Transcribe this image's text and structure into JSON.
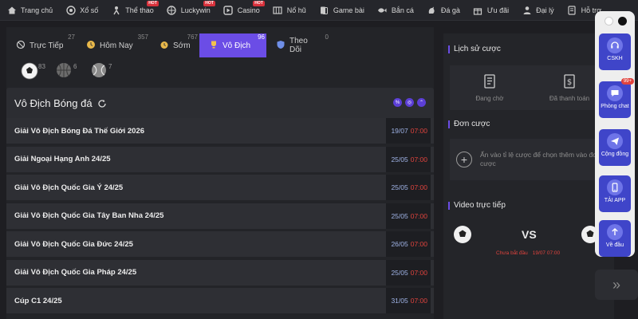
{
  "nav": [
    {
      "label": "Trang chủ",
      "icon": "home-icon",
      "hot": false
    },
    {
      "label": "Xổ số",
      "icon": "lottery-icon",
      "hot": false
    },
    {
      "label": "Thể thao",
      "icon": "sport-icon",
      "hot": true
    },
    {
      "label": "Luckywin",
      "icon": "luckywin-icon",
      "hot": true
    },
    {
      "label": "Casino",
      "icon": "casino-icon",
      "hot": true
    },
    {
      "label": "Nổ hũ",
      "icon": "slot-icon",
      "hot": false
    },
    {
      "label": "Game bài",
      "icon": "cards-icon",
      "hot": false
    },
    {
      "label": "Bắn cá",
      "icon": "fish-icon",
      "hot": false
    },
    {
      "label": "Đá gà",
      "icon": "rooster-icon",
      "hot": false
    },
    {
      "label": "Ưu đãi",
      "icon": "gift-icon",
      "hot": false
    },
    {
      "label": "Đại lý",
      "icon": "agent-icon",
      "hot": false
    },
    {
      "label": "Hỗ trợ",
      "icon": "support-icon",
      "hot": false
    }
  ],
  "hot_label": "HOT",
  "tabs": [
    {
      "label": "Trực Tiếp",
      "count": "27"
    },
    {
      "label": "Hôm Nay",
      "count": "357"
    },
    {
      "label": "Sớm",
      "count": "767"
    },
    {
      "label": "Vô Địch",
      "count": "96"
    },
    {
      "label": "Theo Dõi",
      "count": "0"
    }
  ],
  "sports": [
    {
      "icon": "soccer-ball-icon",
      "count": "83"
    },
    {
      "icon": "basketball-icon",
      "count": "6"
    },
    {
      "icon": "tennis-ball-icon",
      "count": "7"
    }
  ],
  "champ": {
    "title": "Vô Địch Bóng đá"
  },
  "rows": [
    {
      "name": "Giải Vô Địch Bóng Đá Thế Giới 2026",
      "date": "19/07",
      "time": "07:00"
    },
    {
      "name": "Giải Ngoại Hạng Anh 24/25",
      "date": "25/05",
      "time": "07:00"
    },
    {
      "name": "Giải Vô Địch Quốc Gia Ý 24/25",
      "date": "25/05",
      "time": "07:00"
    },
    {
      "name": "Giải Vô Địch Quốc Gia Tây Ban Nha 24/25",
      "date": "25/05",
      "time": "07:00"
    },
    {
      "name": "Giải Vô Địch Quốc Gia Đức 24/25",
      "date": "26/05",
      "time": "07:00"
    },
    {
      "name": "Giải Vô Địch Quốc Gia Pháp 24/25",
      "date": "25/05",
      "time": "07:00"
    },
    {
      "name": "Cúp C1 24/25",
      "date": "31/05",
      "time": "07:00"
    }
  ],
  "right": {
    "history_title": "Lịch sử cược",
    "pending": "Đang chờ",
    "paid": "Đã thanh toán",
    "slip_title": "Đơn cược",
    "slip_hint": "Ấn vào tỉ lệ cược để chọn thêm vào đơn cược",
    "video_title": "Video trực tiếp",
    "vs": "VS",
    "not_started": "Chưa bắt đầu",
    "video_time": "19/07 07:00"
  },
  "side": {
    "cskh": "CSKH",
    "chat": "Phòng chat",
    "chat_badge": "99+",
    "community": "Cộng đồng",
    "app": "TẢI APP",
    "top": "Về đầu",
    "more": "»"
  },
  "colors": {
    "accent": "#6b4de6",
    "side_button": "#3f45c9",
    "time_red": "#e0433d",
    "date_blue": "#9fb3e6"
  }
}
